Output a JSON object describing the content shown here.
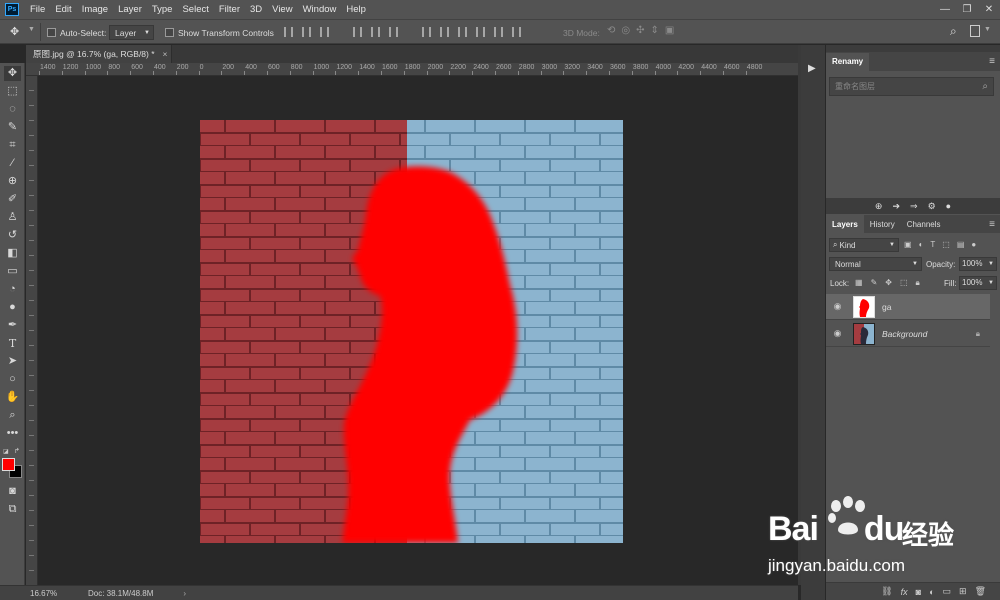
{
  "app": {
    "logo": "Ps"
  },
  "menus": [
    "File",
    "Edit",
    "Image",
    "Layer",
    "Type",
    "Select",
    "Filter",
    "3D",
    "View",
    "Window",
    "Help"
  ],
  "options_bar": {
    "auto_select_label": "Auto-Select:",
    "auto_select_value": "Layer",
    "show_transform_label": "Show Transform Controls",
    "mode_3d_label": "3D Mode:"
  },
  "document_tab": {
    "title": "原图.jpg @ 16.7% (ga, RGB/8) *",
    "close": "×"
  },
  "rulers": {
    "top_labels": [
      "1400",
      "1200",
      "1000",
      "800",
      "600",
      "400",
      "200",
      "0",
      "200",
      "400",
      "600",
      "800",
      "1000",
      "1200",
      "1400",
      "1600",
      "1800",
      "2000",
      "2200",
      "2400",
      "2600",
      "2800",
      "3000",
      "3200",
      "3400",
      "3600",
      "3800",
      "4000",
      "4200",
      "4400",
      "4600",
      "4800"
    ]
  },
  "status_bar": {
    "zoom": "16.67%",
    "doc": "Doc: 38.1M/48.8M",
    "arrow": "›"
  },
  "renamy_panel": {
    "title": "Renamy",
    "search_placeholder": "重命名图层"
  },
  "layers_panel": {
    "tabs": [
      "Layers",
      "History",
      "Channels"
    ],
    "kind_label": "Kind",
    "blend_mode": "Normal",
    "opacity_label": "Opacity:",
    "opacity_value": "100%",
    "lock_label": "Lock:",
    "fill_label": "Fill:",
    "fill_value": "100%",
    "layers": [
      {
        "name": "ga",
        "selected": true
      },
      {
        "name": "Background",
        "selected": false,
        "locked": true
      }
    ],
    "footer_icons": [
      "link-icon",
      "fx-icon",
      "mask-icon",
      "adjustment-icon",
      "folder-icon",
      "new-layer-icon",
      "trash-icon"
    ]
  },
  "colors": {
    "foreground": "#ff0000",
    "background": "#000000",
    "brick_red": "#a53c40",
    "brick_blue": "#8cb4cf"
  },
  "watermark": {
    "brand_a": "Bai",
    "brand_b": "du",
    "brand_cn": "经验",
    "url": "jingyan.baidu.com"
  }
}
